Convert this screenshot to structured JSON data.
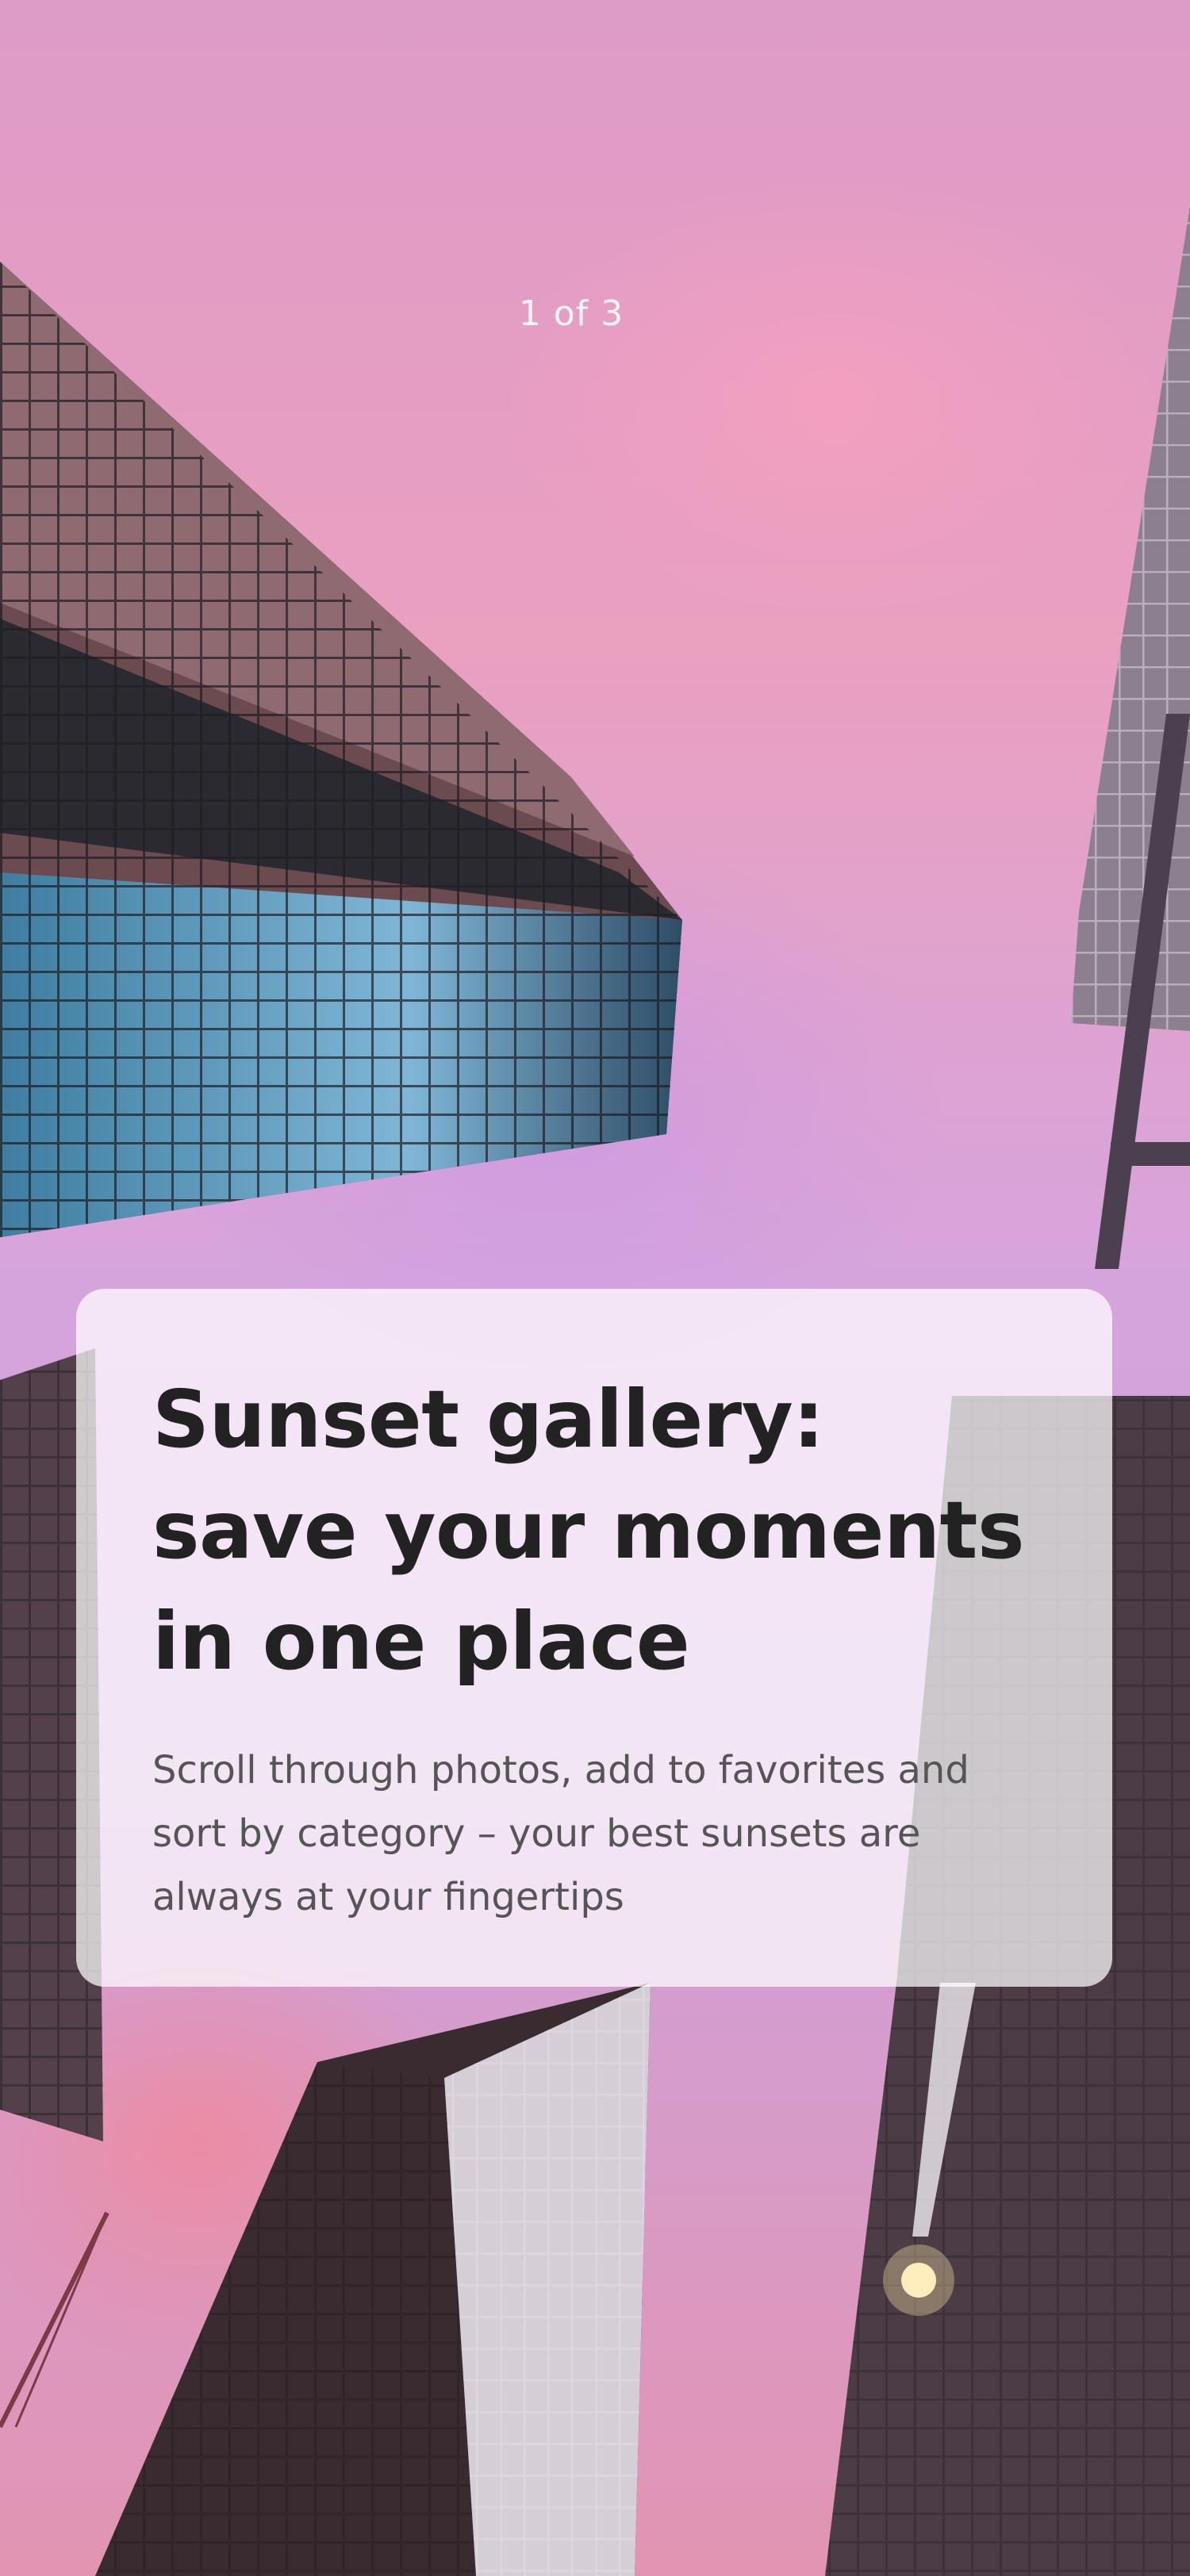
{
  "onboarding": {
    "page_indicator": "1 of 3",
    "title": "Sunset gallery: save your moments in one place",
    "description": "Scroll through photos, add to favorites and sort by category – your best sunsets are always at your fingertips"
  },
  "colors": {
    "title_text": "#222222",
    "body_text": "#555555",
    "card_background": "rgba(255,255,255,0.72)"
  }
}
